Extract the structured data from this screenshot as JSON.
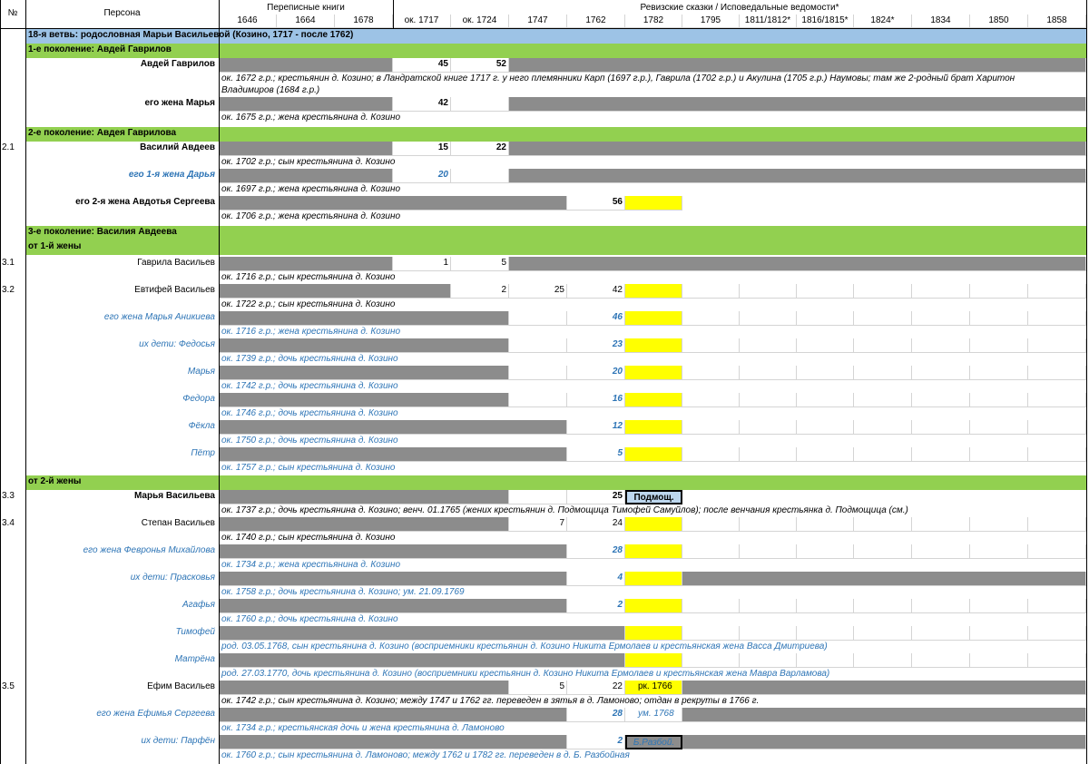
{
  "header": {
    "num_label": "№",
    "persona_label": "Персона",
    "group1_label": "Переписные книги",
    "group2_label": "Ревизские сказки / Исповедальные ведомости*",
    "years": [
      "1646",
      "1664",
      "1678",
      "ок. 1717",
      "ок. 1724",
      "1747",
      "1762",
      "1782",
      "1795",
      "1811/1812*",
      "1816/1815*",
      "1824*",
      "1834",
      "1850",
      "1858"
    ]
  },
  "branch_title": "18-я ветвь: родословная Марьи Васильевой (Козино, 1717 - после 1762)",
  "gen1": {
    "title": "1-е поколение: Авдей Гаврилов",
    "p1_name": "Авдей Гаврилов",
    "p1_v1717": "45",
    "p1_v1724": "52",
    "p1_note1": "ок. 1672 г.р.; крестьянин д. Козино; в Ландратской книге 1717 г. у него племянники Карп (1697 г.р.), Гаврила (1702 г.р.) и Акулина (1705 г.р.) Наумовы; там же 2-родный брат Харитон",
    "p1_note2": "Владимиров (1684 г.р.)",
    "p2_name": "его жена Марья",
    "p2_v1717": "42",
    "p2_note": "ок. 1675 г.р.; жена крестьянина д. Козино"
  },
  "gen2": {
    "title": "2-е поколение: Авдея Гаврилова",
    "p1_num": "2.1",
    "p1_name": "Василий Авдеев",
    "p1_v1717": "15",
    "p1_v1724": "22",
    "p1_note": "ок. 1702 г.р.; сын крестьянина д. Козино",
    "p2_name": "его 1-я жена Дарья",
    "p2_v1717": "20",
    "p2_note": "ок. 1697 г.р.; жена крестьянина д. Козино",
    "p3_name": "его 2-я жена Авдотья Сергеева",
    "p3_v1762": "56",
    "p3_note": "ок. 1706 г.р.; жена крестьянина д. Козино"
  },
  "gen3": {
    "title": "3-е поколение: Василия Авдеева",
    "sub1": "от 1-й жены",
    "r31_num": "3.1",
    "r31_name": "Гаврила Васильев",
    "r31_v1717": "1",
    "r31_v1724": "5",
    "r31_note": "ок. 1716 г.р.; сын крестьянина д. Козино",
    "r32_num": "3.2",
    "r32_name": "Евтифей Васильев",
    "r32_v1724": "2",
    "r32_v1747": "25",
    "r32_v1762": "42",
    "r32_note": "ок. 1722 г.р.; сын крестьянина д. Козино",
    "r32w_name": "его жена Марья Аникиева",
    "r32w_v1762": "46",
    "r32w_note": "ок. 1716 г.р.; жена крестьянина д. Козино",
    "r32c1_name": "их дети: Федосья",
    "r32c1_v1762": "23",
    "r32c1_note": "ок. 1739 г.р.; дочь крестьянина д. Козино",
    "r32c2_name": "Марья",
    "r32c2_v1762": "20",
    "r32c2_note": "ок. 1742 г.р.; дочь крестьянина д. Козино",
    "r32c3_name": "Федора",
    "r32c3_v1762": "16",
    "r32c3_note": "ок. 1746 г.р.; дочь крестьянина д. Козино",
    "r32c4_name": "Фёкла",
    "r32c4_v1762": "12",
    "r32c4_note": "ок. 1750 г.р.; дочь крестьянина д. Козино",
    "r32c5_name": "Пётр",
    "r32c5_v1762": "5",
    "r32c5_note": "ок. 1757 г.р.; сын крестьянина д. Козино",
    "sub2": "от 2-й жены",
    "r33_num": "3.3",
    "r33_name": "Марья Васильева",
    "r33_v1762": "25",
    "r33_v1782": "Подмощ.",
    "r33_note": "ок. 1737 г.р.; дочь крестьянина д. Козино; венч. 01.1765 (жених крестьянин д. Подмощица Тимофей Самуйлов); после венчания крестьянка д. Подмощица (см.)",
    "r34_num": "3.4",
    "r34_name": "Степан Васильев",
    "r34_v1747": "7",
    "r34_v1762": "24",
    "r34_note": "ок. 1740 г.р.; сын крестьянина д. Козино",
    "r34w_name": "его жена Февронья Михайлова",
    "r34w_v1762": "28",
    "r34w_note": "ок. 1734 г.р.; жена крестьянина д. Козино",
    "r34c1_name": "их дети: Прасковья",
    "r34c1_v1762": "4",
    "r34c1_note": "ок. 1758 г.р.; дочь крестьянина д. Козино; ум. 21.09.1769",
    "r34c2_name": "Агафья",
    "r34c2_v1762": "2",
    "r34c2_note": "ок. 1760 г.р.; дочь крестьянина д. Козино",
    "r34c3_name": "Тимофей",
    "r34c3_note": "род. 03.05.1768, сын крестьянина д. Козино (восприемники крестьянин д. Козино Никита Ермолаев и крестьянская жена Васса Дмитриева)",
    "r34c4_name": "Матрёна",
    "r34c4_note": "род. 27.03.1770, дочь крестьянина д. Козино (восприемники крестьянин д. Козино Никита Ермолаев и крестьянская жена Мавра Варламова)",
    "r35_num": "3.5",
    "r35_name": "Ефим Васильев",
    "r35_v1747": "5",
    "r35_v1762": "22",
    "r35_v1782": "рк. 1766",
    "r35_note": "ок. 1742 г.р.; сын крестьянина д. Козино; между 1747 и 1762 гг. переведен в зятья в д. Ламоново; отдан в рекруты в 1766 г.",
    "r35w_name": "его жена Ефимья Сергеева",
    "r35w_v1762": "28",
    "r35w_v1782": "ум. 1768",
    "r35w_note": "ок. 1734 г.р.; крестьянская дочь и жена крестьянина д. Ламоново",
    "r35c1_name": "их дети: Парфён",
    "r35c1_v1762": "2",
    "r35c1_v1782": "Б.Разбой.",
    "r35c1_note": "ок. 1760 г.р.; сын крестьянина д. Ламоново; между 1762 и 1782 гг. переведен в д. Б. Разбойная"
  }
}
